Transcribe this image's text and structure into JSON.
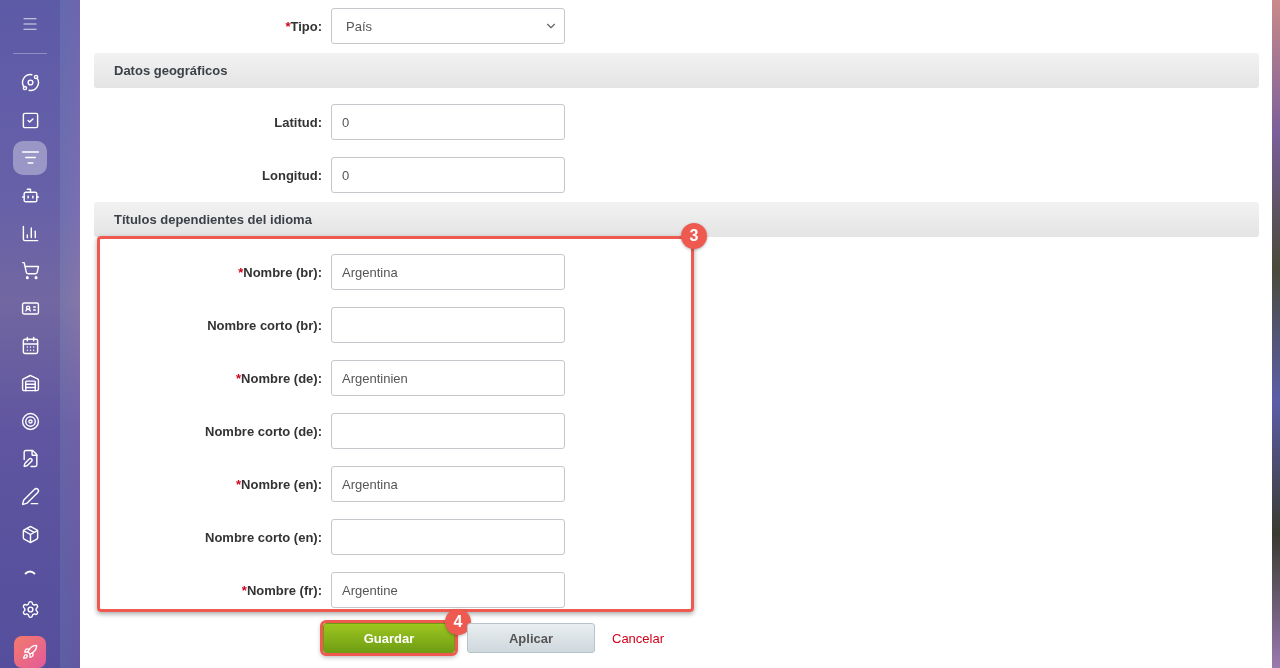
{
  "sidebar": {
    "items": [
      {
        "selected": false
      },
      {
        "selected": false
      },
      {
        "selected": true
      },
      {
        "selected": false
      },
      {
        "selected": false
      },
      {
        "selected": false
      },
      {
        "selected": false
      },
      {
        "selected": false
      },
      {
        "selected": false
      },
      {
        "selected": false
      },
      {
        "selected": false
      },
      {
        "selected": false
      },
      {
        "selected": false
      }
    ]
  },
  "top_fields": [
    {
      "kind": "select",
      "label": "Tipo:",
      "required_mark": "*",
      "value": "País"
    }
  ],
  "sections": [
    {
      "title": "Datos geográficos",
      "highlighted": false,
      "fields": [
        {
          "kind": "text",
          "label": "Latitud:",
          "value": "0"
        },
        {
          "kind": "text",
          "label": "Longitud:",
          "value": "0"
        }
      ]
    },
    {
      "title": "Títulos dependientes del idioma",
      "highlighted": true,
      "badge": "3",
      "fields": [
        {
          "kind": "text",
          "label": "Nombre (br):",
          "required_mark": "*",
          "value": "Argentina"
        },
        {
          "kind": "text",
          "label": "Nombre corto (br):"
        },
        {
          "kind": "text",
          "label": "Nombre (de):",
          "required_mark": "*",
          "value": "Argentinien"
        },
        {
          "kind": "text",
          "label": "Nombre corto (de):"
        },
        {
          "kind": "text",
          "label": "Nombre (en):",
          "required_mark": "*",
          "value": "Argentina"
        },
        {
          "kind": "text",
          "label": "Nombre corto (en):"
        },
        {
          "kind": "text",
          "label": "Nombre (fr):",
          "required_mark": "*",
          "value": "Argentine"
        }
      ]
    }
  ],
  "buttons": [
    {
      "kind": "primary",
      "label": "Guardar",
      "highlighted": true,
      "badge": "4"
    },
    {
      "kind": "secondary",
      "label": "Aplicar",
      "highlighted": false
    },
    {
      "kind": "link",
      "label": "Cancelar",
      "highlighted": false
    }
  ]
}
